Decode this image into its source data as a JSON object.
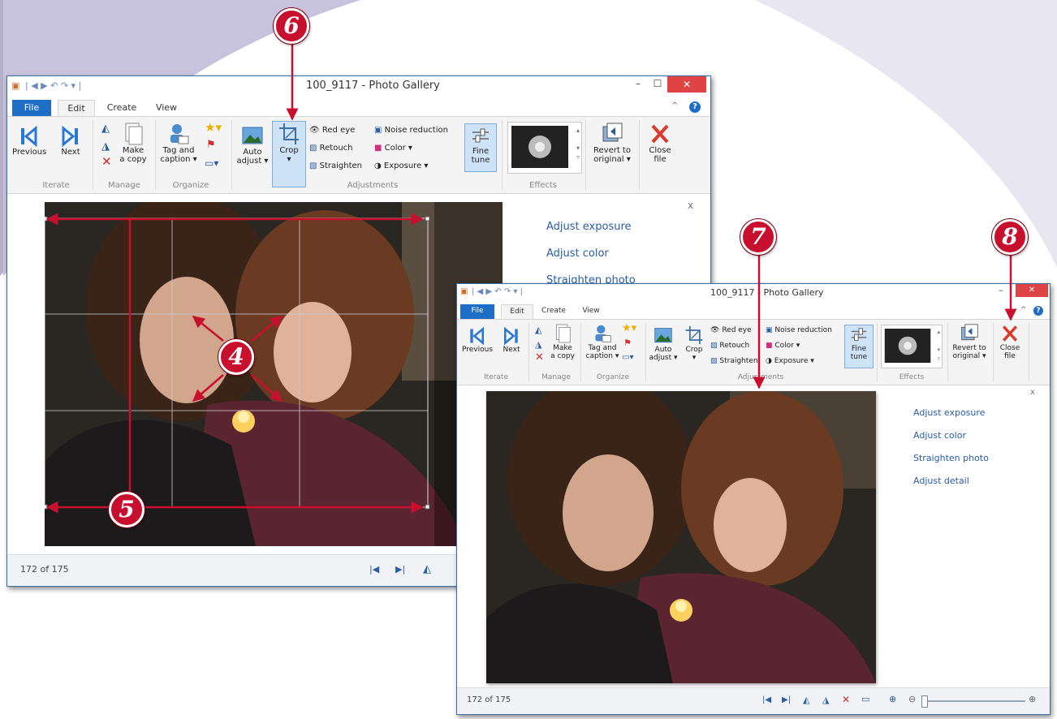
{
  "colors": {
    "accent": "#1e6ec8",
    "callout": "#c8102e",
    "link": "#2a5da8",
    "close": "#e04343"
  },
  "window_back": {
    "title": "100_9117 - Photo Gallery",
    "tabs": [
      "File",
      "Edit",
      "Create",
      "View"
    ],
    "ribbon": {
      "previous": "Previous",
      "next": "Next",
      "make_copy_1": "Make",
      "make_copy_2": "a copy",
      "tag_1": "Tag and",
      "tag_2": "caption ▾",
      "auto_1": "Auto",
      "auto_2": "adjust ▾",
      "crop": "Crop",
      "red_eye": "Red eye",
      "retouch": "Retouch",
      "straighten": "Straighten",
      "noise": "Noise reduction",
      "color": "Color ▾",
      "exposure": "Exposure ▾",
      "fine_1": "Fine",
      "fine_2": "tune",
      "revert_1": "Revert to",
      "revert_2": "original ▾",
      "close_1": "Close",
      "close_2": "file"
    },
    "groups": [
      "Iterate",
      "Manage",
      "Organize",
      "Adjustments",
      "Effects"
    ],
    "pane": {
      "close": "x",
      "items": [
        "Adjust exposure",
        "Adjust color",
        "Straighten photo"
      ]
    },
    "status": "172 of 175"
  },
  "window_front": {
    "title": "100_9117 - Photo Gallery",
    "tabs": [
      "File",
      "Edit",
      "Create",
      "View"
    ],
    "ribbon": {
      "previous": "Previous",
      "next": "Next",
      "make_copy_1": "Make",
      "make_copy_2": "a copy",
      "tag_1": "Tag and",
      "tag_2": "caption ▾",
      "auto_1": "Auto",
      "auto_2": "adjust ▾",
      "crop": "Crop",
      "red_eye": "Red eye",
      "retouch": "Retouch",
      "straighten": "Straighten",
      "noise": "Noise reduction",
      "color": "Color ▾",
      "exposure": "Exposure ▾",
      "fine_1": "Fine",
      "fine_2": "tune",
      "revert_1": "Revert to",
      "revert_2": "original ▾",
      "close_1": "Close",
      "close_2": "file"
    },
    "groups": [
      "Iterate",
      "Manage",
      "Organize",
      "Adjustments",
      "Effects"
    ],
    "pane": {
      "close": "x",
      "items": [
        "Adjust exposure",
        "Adjust color",
        "Straighten photo",
        "Adjust detail"
      ]
    },
    "status": "172 of 175"
  },
  "callouts": {
    "c4": "4",
    "c5": "5",
    "c6": "6",
    "c7": "7",
    "c8": "8"
  }
}
